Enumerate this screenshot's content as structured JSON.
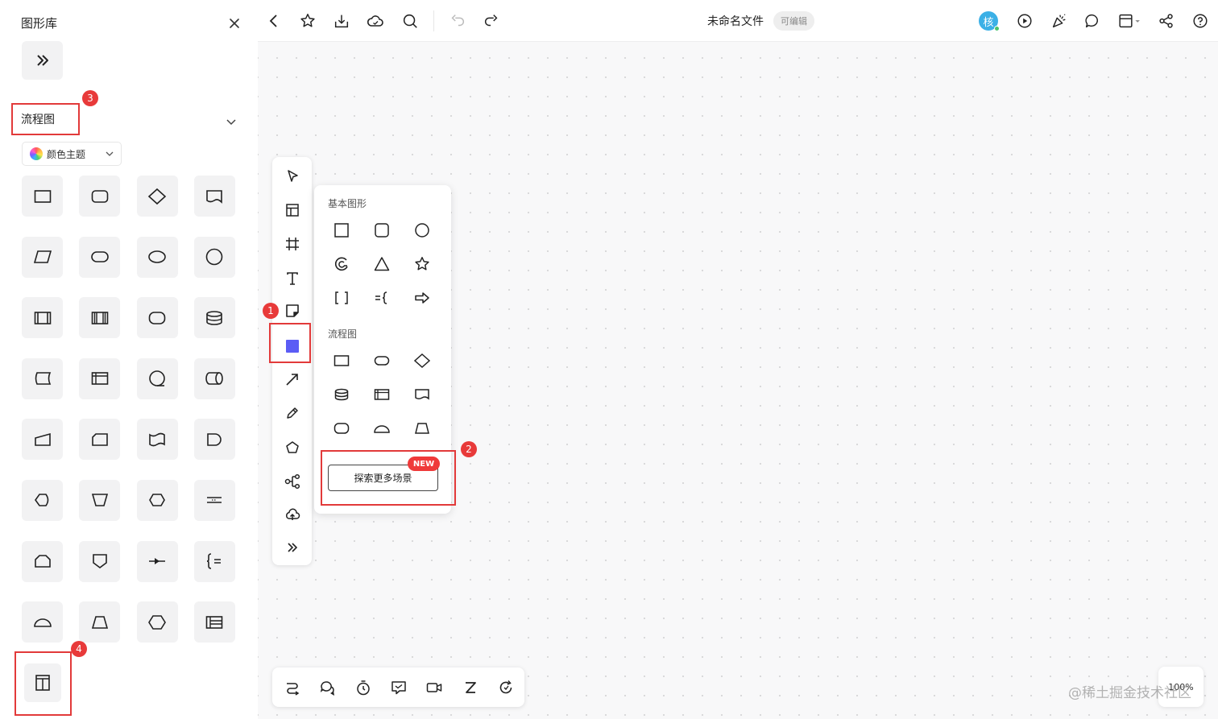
{
  "library": {
    "title": "图形库",
    "section_title": "流程图",
    "theme_button": "颜色主题",
    "shapes": [
      "process",
      "rounded-rect",
      "decision",
      "document",
      "data-io",
      "terminator",
      "ellipse",
      "circle",
      "predefined-process",
      "predefined-process-double",
      "alternate-process",
      "database",
      "stored-data",
      "internal-storage",
      "sequential-data",
      "direct-data",
      "manual-input",
      "card",
      "punched-tape",
      "delay",
      "display",
      "manual-operation",
      "preparation",
      "parallel-mode",
      "loop-limit",
      "off-page-connector",
      "collate",
      "annotation",
      "semicircle",
      "trapezoid",
      "hexagon",
      "swimlane"
    ],
    "bottom_shape": "container-icon"
  },
  "topbar": {
    "doc_title": "未命名文件",
    "doc_badge": "可编辑",
    "avatar_text": "核"
  },
  "popup": {
    "basic_label": "基本图形",
    "flow_label": "流程图",
    "explore_button": "探索更多场景",
    "new_tag": "NEW"
  },
  "annotations": [
    "1",
    "2",
    "3",
    "4"
  ],
  "zoom": "100%",
  "watermark": "@稀土掘金技术社区",
  "colors": {
    "accent": "#5b5cf5",
    "annotation_red": "#e23a3a",
    "avatar": "#3bb0e6"
  }
}
